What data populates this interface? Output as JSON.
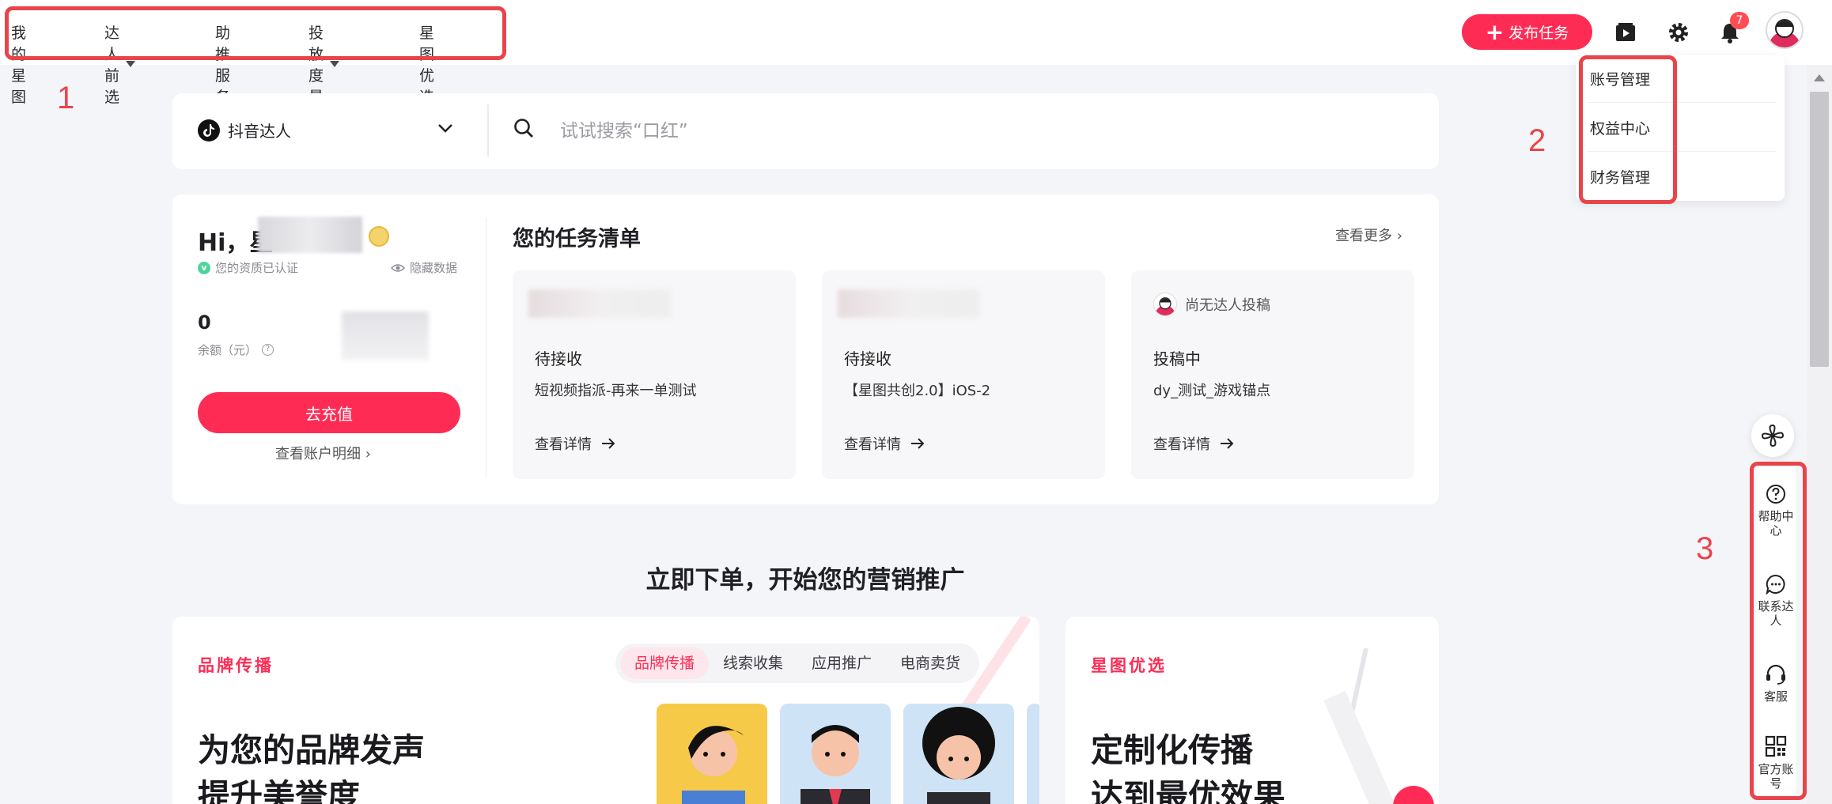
{
  "nav": {
    "items": [
      {
        "label": "我的星图",
        "has_caret": false
      },
      {
        "label": "达人前选",
        "has_caret": true
      },
      {
        "label": "助推服务",
        "has_caret": false
      },
      {
        "label": "投放度量",
        "has_caret": true
      },
      {
        "label": "星图优选",
        "has_caret": false
      }
    ]
  },
  "header": {
    "publish_label": "发布任务",
    "notification_count": "7",
    "icons": [
      "video-play-icon",
      "gear-icon",
      "bell-icon",
      "avatar"
    ]
  },
  "account_menu": {
    "items": [
      "账号管理",
      "权益中心",
      "财务管理"
    ]
  },
  "annotations": {
    "n1": "1",
    "n2": "2",
    "n3": "3"
  },
  "search": {
    "platform": "抖音达人",
    "placeholder": "试试搜索“口红”"
  },
  "account": {
    "greeting": "Hi，星",
    "verified_text": "您的资质已认证",
    "hide_data_label": "隐藏数据",
    "balance": "0",
    "balance_label": "余额（元）",
    "recharge_label": "去充值",
    "account_detail_link": "查看账户明细 ›"
  },
  "tasks": {
    "title": "您的任务清单",
    "see_more": "查看更多 ›",
    "items": [
      {
        "status": "待接收",
        "name": "短视频指派-再来一单测试",
        "detail": "查看详情"
      },
      {
        "status": "待接收",
        "name": "【星图共创2.0】iOS-2",
        "detail": "查看详情"
      },
      {
        "status": "投稿中",
        "name": "dy_测试_游戏锚点",
        "detail": "查看详情",
        "header": "尚无达人投稿"
      }
    ]
  },
  "promo": {
    "section_title": "立即下单，开始您的营销推广",
    "left": {
      "label": "品牌传播",
      "tabs": [
        "品牌传播",
        "线索收集",
        "应用推广",
        "电商卖货"
      ],
      "active_tab": "品牌传播",
      "heading_line1": "为您的品牌发声",
      "heading_line2": "提升美誉度"
    },
    "right": {
      "label": "星图优选",
      "heading_line1": "定制化传播",
      "heading_line2": "达到最优效果"
    }
  },
  "sidebar": {
    "items": [
      {
        "label": "帮助中心",
        "icon": "help-icon"
      },
      {
        "label": "联系达人",
        "icon": "chat-icon"
      },
      {
        "label": "客服",
        "icon": "headset-icon"
      },
      {
        "label": "官方账号",
        "icon": "qrcode-icon"
      }
    ]
  },
  "colors": {
    "brand": "#fe2c55",
    "annotation": "#e8454b"
  }
}
